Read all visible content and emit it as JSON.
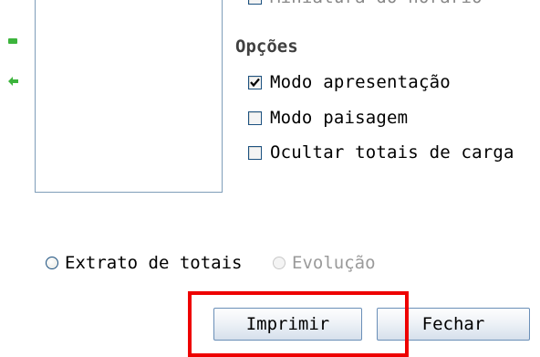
{
  "partial_option_label": "Miniatura do horário",
  "options": {
    "title": "Opções",
    "items": [
      {
        "label": "Modo apresentação",
        "checked": true
      },
      {
        "label": "Modo paisagem",
        "checked": false
      },
      {
        "label": "Ocultar totais de carga",
        "checked": false
      }
    ]
  },
  "report_type": {
    "items": [
      {
        "label": "Extrato de totais",
        "selected": false,
        "enabled": true
      },
      {
        "label": "Evolução",
        "selected": false,
        "enabled": false
      }
    ]
  },
  "buttons": {
    "print_label": "Imprimir",
    "close_label": "Fechar"
  },
  "colors": {
    "highlight": "#ee0000",
    "button_border": "#6a8fb8",
    "checkbox_border": "#1c5180"
  }
}
